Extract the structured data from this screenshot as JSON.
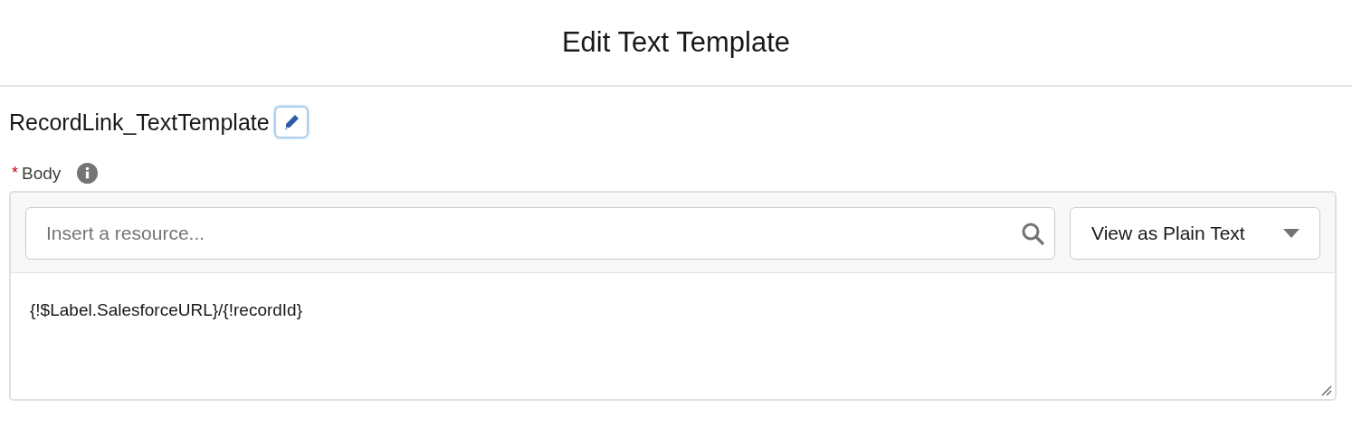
{
  "modal": {
    "title": "Edit Text Template"
  },
  "template": {
    "name": "RecordLink_TextTemplate"
  },
  "body_field": {
    "label": "Body",
    "required_mark": "*",
    "resource_search": {
      "placeholder": "Insert a resource..."
    },
    "view_mode": {
      "value": "View as Plain Text"
    },
    "content": "{!$Label.SalesforceURL}/{!recordId}"
  }
}
